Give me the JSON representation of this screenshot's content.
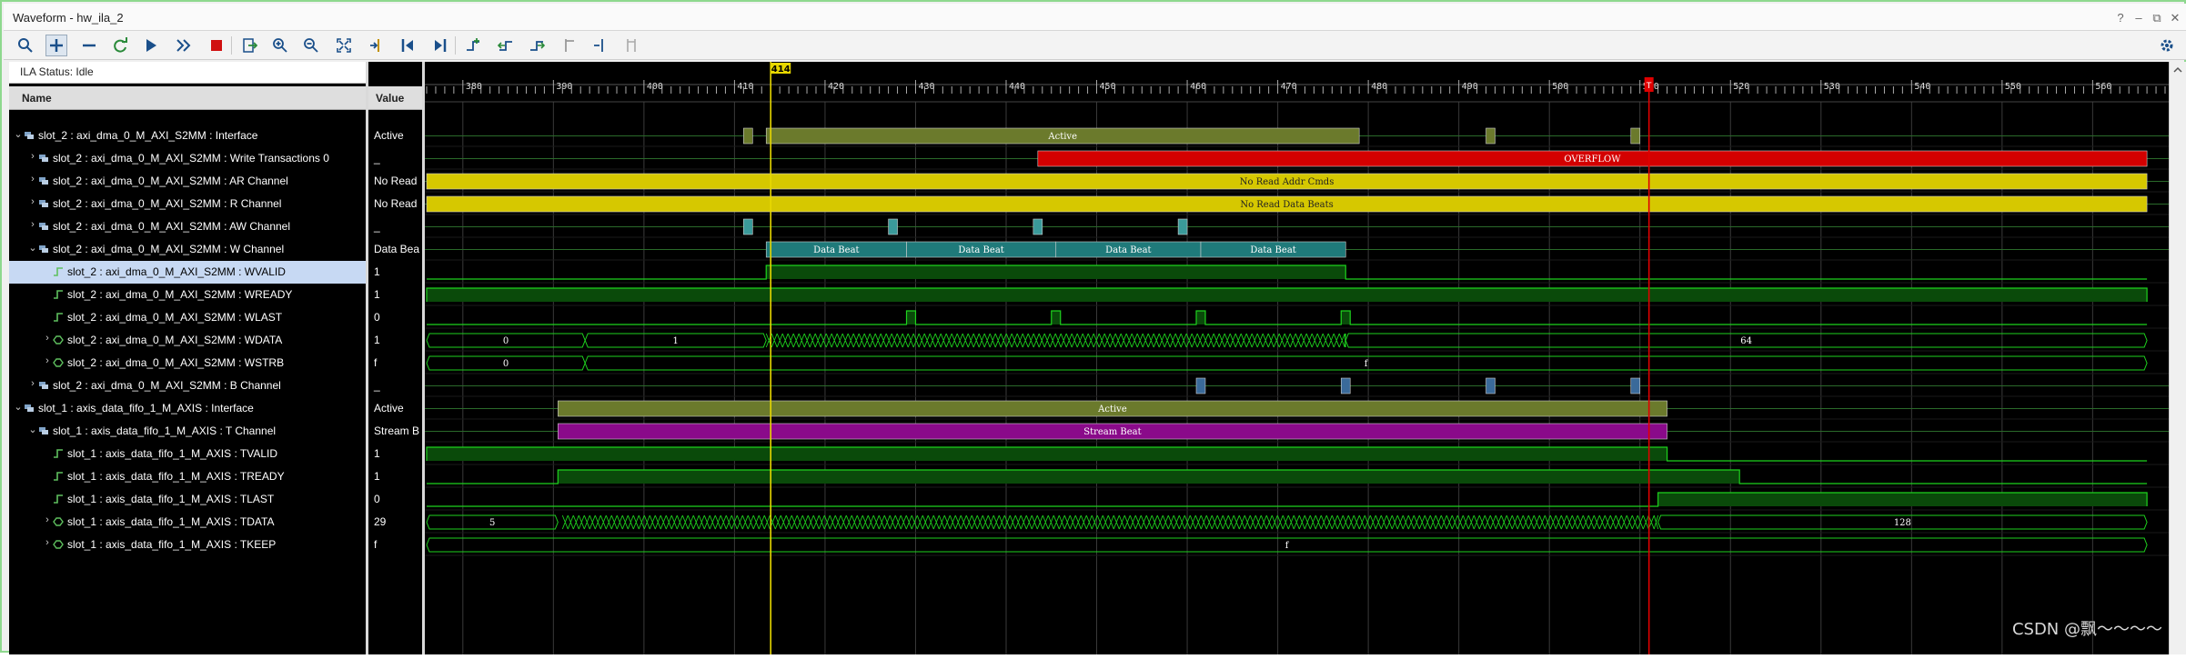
{
  "window": {
    "title": "Waveform - hw_ila_2",
    "controls": [
      "?",
      "–",
      "⧉",
      "✕"
    ]
  },
  "toolbar": {
    "buttons": [
      "search-icon",
      "add-icon",
      "remove-icon",
      "refresh-icon",
      "run-icon",
      "run-all-icon",
      "stop-icon",
      "export-icon",
      "zoom-in-icon",
      "zoom-out-icon",
      "zoom-fit-icon",
      "goto-cursor-icon",
      "goto-first-icon",
      "goto-last-icon",
      "add-marker-icon",
      "prev-transition-icon",
      "next-transition-icon",
      "marker-prev-icon",
      "marker-next-icon",
      "marker-disabled-icon"
    ],
    "settings_icon": "gear-icon"
  },
  "ila_status": "ILA Status: Idle",
  "columns": {
    "name": "Name",
    "value": "Value"
  },
  "signals": [
    {
      "label": "slot_2 : axi_dma_0_M_AXI_S2MM : Interface",
      "value": "Active",
      "indent": 0,
      "expander": "v",
      "type": "interface"
    },
    {
      "label": "slot_2 : axi_dma_0_M_AXI_S2MM : Write Transactions 0",
      "value": "_",
      "indent": 1,
      "expander": ">",
      "type": "interface"
    },
    {
      "label": "slot_2 : axi_dma_0_M_AXI_S2MM : AR Channel",
      "value": "No Read",
      "indent": 1,
      "expander": ">",
      "type": "interface"
    },
    {
      "label": "slot_2 : axi_dma_0_M_AXI_S2MM : R Channel",
      "value": "No Read",
      "indent": 1,
      "expander": ">",
      "type": "interface"
    },
    {
      "label": "slot_2 : axi_dma_0_M_AXI_S2MM : AW Channel",
      "value": "_",
      "indent": 1,
      "expander": ">",
      "type": "interface"
    },
    {
      "label": "slot_2 : axi_dma_0_M_AXI_S2MM : W Channel",
      "value": "Data Bea",
      "indent": 1,
      "expander": "v",
      "type": "interface"
    },
    {
      "label": "slot_2 : axi_dma_0_M_AXI_S2MM : WVALID",
      "value": "1",
      "indent": 2,
      "expander": "",
      "type": "bit",
      "selected": true
    },
    {
      "label": "slot_2 : axi_dma_0_M_AXI_S2MM : WREADY",
      "value": "1",
      "indent": 2,
      "expander": "",
      "type": "bit"
    },
    {
      "label": "slot_2 : axi_dma_0_M_AXI_S2MM : WLAST",
      "value": "0",
      "indent": 2,
      "expander": "",
      "type": "bit"
    },
    {
      "label": "slot_2 : axi_dma_0_M_AXI_S2MM : WDATA",
      "value": "1",
      "indent": 2,
      "expander": ">",
      "type": "bus"
    },
    {
      "label": "slot_2 : axi_dma_0_M_AXI_S2MM : WSTRB",
      "value": "f",
      "indent": 2,
      "expander": ">",
      "type": "bus"
    },
    {
      "label": "slot_2 : axi_dma_0_M_AXI_S2MM : B Channel",
      "value": "_",
      "indent": 1,
      "expander": ">",
      "type": "interface"
    },
    {
      "label": "slot_1 : axis_data_fifo_1_M_AXIS : Interface",
      "value": "Active",
      "indent": 0,
      "expander": "v",
      "type": "interface"
    },
    {
      "label": "slot_1 : axis_data_fifo_1_M_AXIS : T Channel",
      "value": "Stream B",
      "indent": 1,
      "expander": "v",
      "type": "interface"
    },
    {
      "label": "slot_1 : axis_data_fifo_1_M_AXIS : TVALID",
      "value": "1",
      "indent": 2,
      "expander": "",
      "type": "bit"
    },
    {
      "label": "slot_1 : axis_data_fifo_1_M_AXIS : TREADY",
      "value": "1",
      "indent": 2,
      "expander": "",
      "type": "bit"
    },
    {
      "label": "slot_1 : axis_data_fifo_1_M_AXIS : TLAST",
      "value": "0",
      "indent": 2,
      "expander": "",
      "type": "bit"
    },
    {
      "label": "slot_1 : axis_data_fifo_1_M_AXIS : TDATA",
      "value": "29",
      "indent": 2,
      "expander": ">",
      "type": "bus"
    },
    {
      "label": "slot_1 : axis_data_fifo_1_M_AXIS : TKEEP",
      "value": "f",
      "indent": 2,
      "expander": ">",
      "type": "bus"
    }
  ],
  "timeline": {
    "start": 376,
    "end": 568,
    "ticks": [
      380,
      390,
      400,
      410,
      420,
      430,
      440,
      450,
      460,
      470,
      480,
      490,
      500,
      510,
      520,
      530,
      540,
      550,
      560
    ],
    "cursor": {
      "label": "414",
      "sample": 414,
      "color": "#e8d800"
    },
    "trigger": {
      "label": "T",
      "sample": 511,
      "color": "#e00000"
    }
  },
  "waves": [
    {
      "row": 0,
      "kind": "intf",
      "segments": [
        {
          "from": 411,
          "to": 412,
          "color": "#6b7a2c",
          "text": ""
        },
        {
          "from": 413.5,
          "to": 479,
          "color": "#6b7a2c",
          "text": "Active"
        },
        {
          "from": 493,
          "to": 494,
          "color": "#6b7a2c",
          "text": ""
        },
        {
          "from": 509,
          "to": 510,
          "color": "#6b7a2c",
          "text": ""
        }
      ]
    },
    {
      "row": 1,
      "kind": "intf",
      "segments": [
        {
          "from": 443.5,
          "to": 566,
          "color": "#d40000",
          "text": "OVERFLOW"
        }
      ]
    },
    {
      "row": 2,
      "kind": "intf",
      "segments": [
        {
          "from": 376,
          "to": 566,
          "color": "#d6c800",
          "text": "No Read Addr Cmds"
        }
      ]
    },
    {
      "row": 3,
      "kind": "intf",
      "segments": [
        {
          "from": 376,
          "to": 566,
          "color": "#d6c800",
          "text": "No Read Data Beats"
        }
      ]
    },
    {
      "row": 4,
      "kind": "intf",
      "segments": [
        {
          "from": 411,
          "to": 412,
          "color": "#3a9a9a",
          "text": ""
        },
        {
          "from": 427,
          "to": 428,
          "color": "#3a9a9a",
          "text": ""
        },
        {
          "from": 443,
          "to": 444,
          "color": "#3a9a9a",
          "text": ""
        },
        {
          "from": 459,
          "to": 460,
          "color": "#3a9a9a",
          "text": ""
        }
      ]
    },
    {
      "row": 5,
      "kind": "intf",
      "segments": [
        {
          "from": 413.5,
          "to": 429,
          "color": "#1f7a7a",
          "text": "Data Beat"
        },
        {
          "from": 429,
          "to": 445.5,
          "color": "#1f7a7a",
          "text": "Data Beat"
        },
        {
          "from": 445.5,
          "to": 461.5,
          "color": "#1f7a7a",
          "text": "Data Beat"
        },
        {
          "from": 461.5,
          "to": 477.5,
          "color": "#1f7a7a",
          "text": "Data Beat"
        }
      ]
    },
    {
      "row": 6,
      "kind": "bit",
      "highs": [
        [
          413.5,
          477.5
        ]
      ]
    },
    {
      "row": 7,
      "kind": "bit",
      "highs": [
        [
          376,
          566
        ]
      ]
    },
    {
      "row": 8,
      "kind": "bit",
      "highs": [
        [
          429,
          430
        ],
        [
          445,
          446
        ],
        [
          461,
          462
        ],
        [
          477,
          478
        ]
      ]
    },
    {
      "row": 9,
      "kind": "bus",
      "xfrom": 413.5,
      "xto": 477.5,
      "segments": [
        {
          "from": 376,
          "to": 393.5,
          "text": "0"
        },
        {
          "from": 393.5,
          "to": 413.5,
          "text": "1"
        },
        {
          "from": 477.5,
          "to": 566,
          "text": "64"
        }
      ]
    },
    {
      "row": 10,
      "kind": "bus",
      "segments": [
        {
          "from": 376,
          "to": 393.5,
          "text": "0"
        },
        {
          "from": 393.5,
          "to": 566,
          "text": "f"
        }
      ]
    },
    {
      "row": 11,
      "kind": "intf",
      "segments": [
        {
          "from": 461,
          "to": 462,
          "color": "#3a6a9a",
          "text": ""
        },
        {
          "from": 477,
          "to": 478,
          "color": "#3a6a9a",
          "text": ""
        },
        {
          "from": 493,
          "to": 494,
          "color": "#3a6a9a",
          "text": ""
        },
        {
          "from": 509,
          "to": 510,
          "color": "#3a6a9a",
          "text": ""
        }
      ]
    },
    {
      "row": 12,
      "kind": "intf",
      "segments": [
        {
          "from": 390.5,
          "to": 513,
          "color": "#6b7a2c",
          "text": "Active"
        }
      ]
    },
    {
      "row": 13,
      "kind": "intf",
      "segments": [
        {
          "from": 390.5,
          "to": 513,
          "color": "#8a0a8a",
          "text": "Stream Beat"
        }
      ]
    },
    {
      "row": 14,
      "kind": "bit",
      "highs": [
        [
          376,
          513
        ]
      ]
    },
    {
      "row": 15,
      "kind": "bit",
      "highs": [
        [
          390.5,
          521
        ]
      ]
    },
    {
      "row": 16,
      "kind": "bit",
      "highs": [
        [
          512,
          566
        ]
      ]
    },
    {
      "row": 17,
      "kind": "bus",
      "xfrom": 391,
      "xto": 512,
      "segments": [
        {
          "from": 376,
          "to": 390.5,
          "text": "5"
        },
        {
          "from": 512,
          "to": 566,
          "text": "128"
        }
      ]
    },
    {
      "row": 18,
      "kind": "bus",
      "segments": [
        {
          "from": 376,
          "to": 566,
          "text": "f"
        }
      ]
    }
  ],
  "watermark": "CSDN @飘～～～～"
}
